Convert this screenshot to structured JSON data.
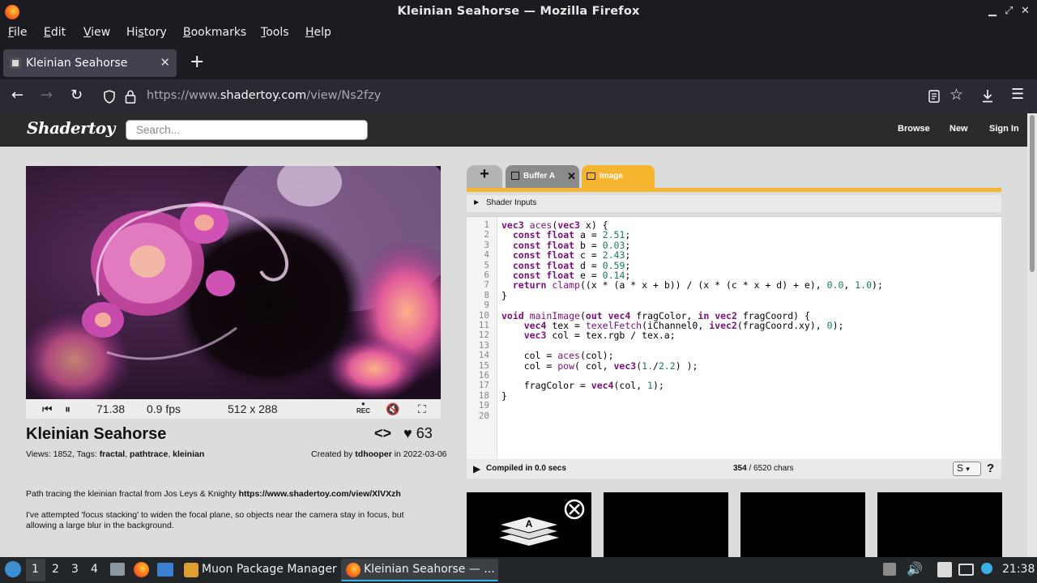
{
  "window": {
    "title": "Kleinian Seahorse — Mozilla Firefox"
  },
  "menu": [
    "File",
    "Edit",
    "View",
    "History",
    "Bookmarks",
    "Tools",
    "Help"
  ],
  "menu_keys": [
    "F",
    "E",
    "V",
    "s",
    "B",
    "T",
    "H"
  ],
  "tab": {
    "title": "Kleinian Seahorse"
  },
  "url": {
    "prefix": "https://www.",
    "host": "shadertoy.com",
    "path": "/view/Ns2fzy"
  },
  "site": {
    "logo": "Shadertoy",
    "search_placeholder": "Search...",
    "nav": [
      "Browse",
      "New",
      "Sign In"
    ]
  },
  "player": {
    "time": "71.38",
    "fps": "0.9 fps",
    "resolution": "512 x 288",
    "rec_label": "REC"
  },
  "shader": {
    "title": "Kleinian Seahorse",
    "likes": "63",
    "views_label": "Views: 1852, Tags:",
    "tags": [
      "fractal",
      "pathtrace",
      "kleinian"
    ],
    "created_label": "Created by",
    "author": "tdhooper",
    "date_label": "in 2022-03-06",
    "desc1": "Path tracing the kleinian fractal from Jos Leys & Knighty",
    "desc1_link": "https://www.shadertoy.com/view/XlVXzh",
    "desc2": "I've attempted 'focus stacking' to widen the focal plane, so objects near the camera stay in focus, but allowing a large blur in the background."
  },
  "editor": {
    "tabs": [
      "Buffer A",
      "Image"
    ],
    "inputs_label": "Shader Inputs",
    "compiled": "Compiled in 0.0 secs",
    "chars_used": "354",
    "chars_total": "/ 6520 chars",
    "font_select": "S",
    "help": "?"
  },
  "code_lines": [
    "vec3 aces(vec3 x) {",
    "  const float a = 2.51;",
    "  const float b = 0.03;",
    "  const float c = 2.43;",
    "  const float d = 0.59;",
    "  const float e = 0.14;",
    "  return clamp((x * (a * x + b)) / (x * (c * x + d) + e), 0.0, 1.0);",
    "}",
    "",
    "void mainImage(out vec4 fragColor, in vec2 fragCoord) {",
    "    vec4 tex = texelFetch(iChannel0, ivec2(fragCoord.xy), 0);",
    "    vec3 col = tex.rgb / tex.a;",
    "",
    "    col = aces(col);",
    "    col = pow( col, vec3(1./2.2) );",
    "",
    "    fragColor = vec4(col, 1);",
    "}",
    "",
    ""
  ],
  "taskbar": {
    "workspaces": [
      "1",
      "2",
      "3",
      "4"
    ],
    "tasks": [
      "Muon Package Manager",
      "Kleinian Seahorse — ..."
    ],
    "clock": "21:38"
  },
  "colors": {
    "accent": "#f6b52f",
    "keyword": "#7a0f7a",
    "number": "#157a5d"
  }
}
